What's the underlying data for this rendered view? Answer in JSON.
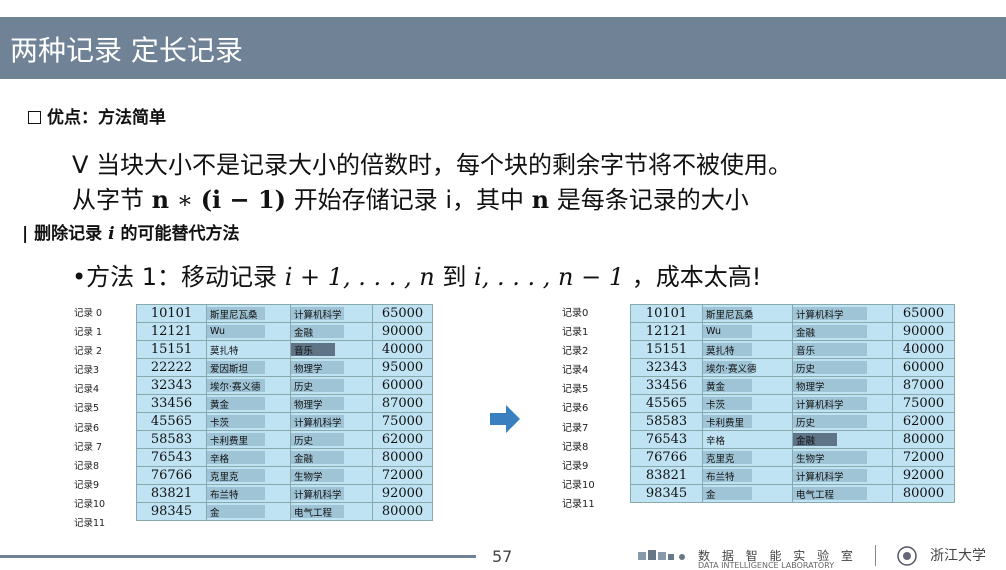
{
  "slide": {
    "title": "两种记录 定长记录",
    "advantage": "优点：方法简单",
    "line1": "当块大小不是记录大小的倍数时，每个块的剩余字节将不被使用。",
    "line1_bullet": "V",
    "line2_pre": "从字节",
    "line2_n": "n",
    "line2_op": "∗",
    "line2_paren": "(i − 1)",
    "line2_mid": "开始存储记录 i，其中",
    "line2_n2": "n",
    "line2_post": "是每条记录的大小",
    "delete_prefix": "删除记录",
    "delete_i": "i",
    "delete_suffix": "的可能替代方法",
    "method_pre": "•方法 1：移动记录",
    "method_math1": "i + 1, . . . , n",
    "method_to": "到",
    "method_math2": "i, . . . , n − 1",
    "method_post": "，成本太高!"
  },
  "left_table": {
    "labels": [
      "记录 0",
      "记录 1",
      "记录 2",
      "记录3",
      "记录4",
      "记录5",
      "记录6",
      "记录 7",
      "记录8",
      "记录9",
      "记录10",
      "记录11"
    ],
    "rows": [
      [
        "10101",
        "斯里尼瓦桑",
        "计算机科学",
        "65000"
      ],
      [
        "12121",
        "Wu",
        "金融",
        "90000"
      ],
      [
        "15151",
        "莫扎特",
        "音乐",
        "40000"
      ],
      [
        "22222",
        "爱因斯坦",
        "物理学",
        "95000"
      ],
      [
        "32343",
        "埃尔·赛义德",
        "历史",
        "60000"
      ],
      [
        "33456",
        "黄金",
        "物理学",
        "87000"
      ],
      [
        "45565",
        "卡茨",
        "计算机科学",
        "75000"
      ],
      [
        "58583",
        "卡利费里",
        "历史",
        "62000"
      ],
      [
        "76543",
        "辛格",
        "金融",
        "80000"
      ],
      [
        "76766",
        "克里克",
        "生物学",
        "72000"
      ],
      [
        "83821",
        "布兰特",
        "计算机科学",
        "92000"
      ],
      [
        "98345",
        "金",
        "电气工程",
        "80000"
      ]
    ]
  },
  "right_table": {
    "labels": [
      "记录0",
      "记录1",
      "记录2",
      "记录4",
      "记录5",
      "记录6",
      "记录7",
      "记录8",
      "记录9",
      "记录10",
      "记录11"
    ],
    "rows": [
      [
        "10101",
        "斯里尼瓦桑",
        "计算机科学",
        "65000"
      ],
      [
        "12121",
        "Wu",
        "金融",
        "90000"
      ],
      [
        "15151",
        "莫扎特",
        "音乐",
        "40000"
      ],
      [
        "32343",
        "埃尔·赛义德",
        "历史",
        "60000"
      ],
      [
        "33456",
        "黄金",
        "物理学",
        "87000"
      ],
      [
        "45565",
        "卡茨",
        "计算机科学",
        "75000"
      ],
      [
        "58583",
        "卡利费里",
        "历史",
        "62000"
      ],
      [
        "76543",
        "辛格",
        "金融",
        "80000"
      ],
      [
        "76766",
        "克里克",
        "生物学",
        "72000"
      ],
      [
        "83821",
        "布兰特",
        "计算机科学",
        "92000"
      ],
      [
        "98345",
        "金",
        "电气工程",
        "80000"
      ]
    ]
  },
  "footer": {
    "page_number": "57",
    "lab_name": "数 据 智 能 实 验 室",
    "lab_name_en": "DATA INTELLIGENCE LABORATORY",
    "university": "浙江大学"
  },
  "colors": {
    "title_bar": "#6f8296",
    "table_bg": "#bfe3f3",
    "arrow": "#3a7fc0"
  },
  "icons": {
    "arrow": "right-arrow-icon",
    "checkbox": "square-bullet-icon"
  }
}
